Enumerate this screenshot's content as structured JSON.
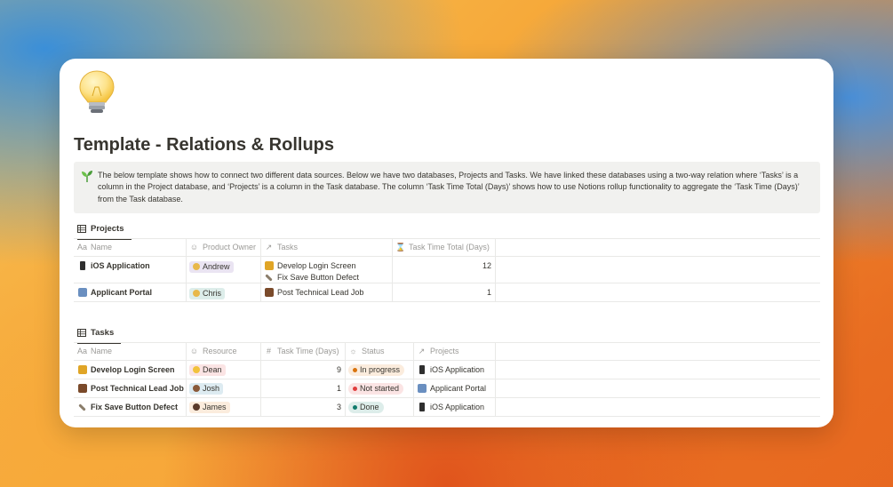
{
  "page": {
    "title": "Template - Relations & Rollups",
    "callout": "The below template shows how to connect two different data sources. Below we have two databases, Projects and Tasks. We have linked these databases using a two-way relation where ‘Tasks’ is a column in the Project database, and ‘Projects’ is a column in the Task database. The column ‘Task Time Total (Days)’ shows how to use Notions rollup functionality to aggregate the ‘Task Time (Days)’ from the Task database."
  },
  "projects": {
    "view_label": "Projects",
    "columns": [
      "Name",
      "Product Owner",
      "Tasks",
      "Task Time Total (Days)"
    ],
    "rows": [
      {
        "name": "iOS Application",
        "owner": "Andrew",
        "tasks": [
          "Develop Login Screen",
          "Fix Save Button Defect"
        ],
        "total": "12"
      },
      {
        "name": "Applicant Portal",
        "owner": "Chris",
        "tasks": [
          "Post Technical Lead Job"
        ],
        "total": "1"
      }
    ]
  },
  "tasks": {
    "view_label": "Tasks",
    "columns": [
      "Name",
      "Resource",
      "Task Time (Days)",
      "Status",
      "Projects"
    ],
    "rows": [
      {
        "name": "Develop Login Screen",
        "resource": "Dean",
        "time": "9",
        "status": "In progress",
        "project": "iOS Application"
      },
      {
        "name": "Post Technical Lead Job",
        "resource": "Josh",
        "time": "1",
        "status": "Not started",
        "project": "Applicant Portal"
      },
      {
        "name": "Fix Save Button Defect",
        "resource": "James",
        "time": "3",
        "status": "Done",
        "project": "iOS Application"
      }
    ]
  },
  "colors": {
    "in_progress_bg": "#fbecdd",
    "in_progress_dot": "#d9730d",
    "not_started_bg": "#fbe4e4",
    "not_started_dot": "#e03e3e",
    "done_bg": "#ddedea",
    "done_dot": "#0f7b6c",
    "andrew_bg": "#eae4f2",
    "chris_bg": "#ddedea",
    "dean_bg": "#fbe4e4",
    "josh_bg": "#ddebf1",
    "james_bg": "#fbecdd"
  },
  "icons": {
    "page": "lightbulb-icon",
    "callout": "seedling-icon",
    "table_view": "table-icon",
    "name_col": "text-aa-icon",
    "person_col": "person-icon",
    "relation_col": "arrow-up-right-icon",
    "rollup_col": "hourglass-icon",
    "number_col": "hash-icon",
    "status_col": "status-icon"
  }
}
